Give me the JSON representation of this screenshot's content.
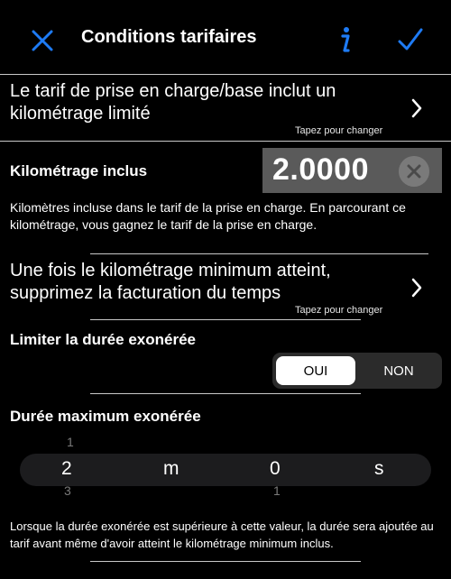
{
  "nav": {
    "title": "Conditions tarifaires",
    "close_icon": "close-x-icon",
    "info_icon": "info-icon",
    "confirm_icon": "checkmark-icon",
    "accent": "#1e7bf5"
  },
  "base_mileage": {
    "label": "Le tarif de prise en charge/base inclut un kilométrage limité",
    "hint": "Tapez pour changer"
  },
  "included_km": {
    "label": "Kilométrage inclus",
    "value": "2.0000",
    "description": "Kilomètres incluse dans le tarif de la prise en charge. En parcourant ce kilométrage, vous gagnez le tarif de la prise en charge."
  },
  "remove_time_billing": {
    "label": "Une fois le kilométrage minimum atteint, supprimez la facturation du temps",
    "hint": "Tapez pour changer"
  },
  "limit_exempt": {
    "label": "Limiter la durée exonérée",
    "options": [
      "OUI",
      "NON"
    ],
    "selected": "OUI"
  },
  "max_exempt": {
    "label": "Durée maximum exonérée",
    "picker": {
      "minutes": "2",
      "minutes_unit": "m",
      "seconds": "0",
      "seconds_unit": "s",
      "minutes_above": "1",
      "minutes_below": "3",
      "seconds_below": "1"
    },
    "description": "Lorsque la durée exonérée est supérieure à cette valeur, la durée sera ajoutée au tarif avant même d'avoir atteint le kilométrage minimum inclus."
  }
}
